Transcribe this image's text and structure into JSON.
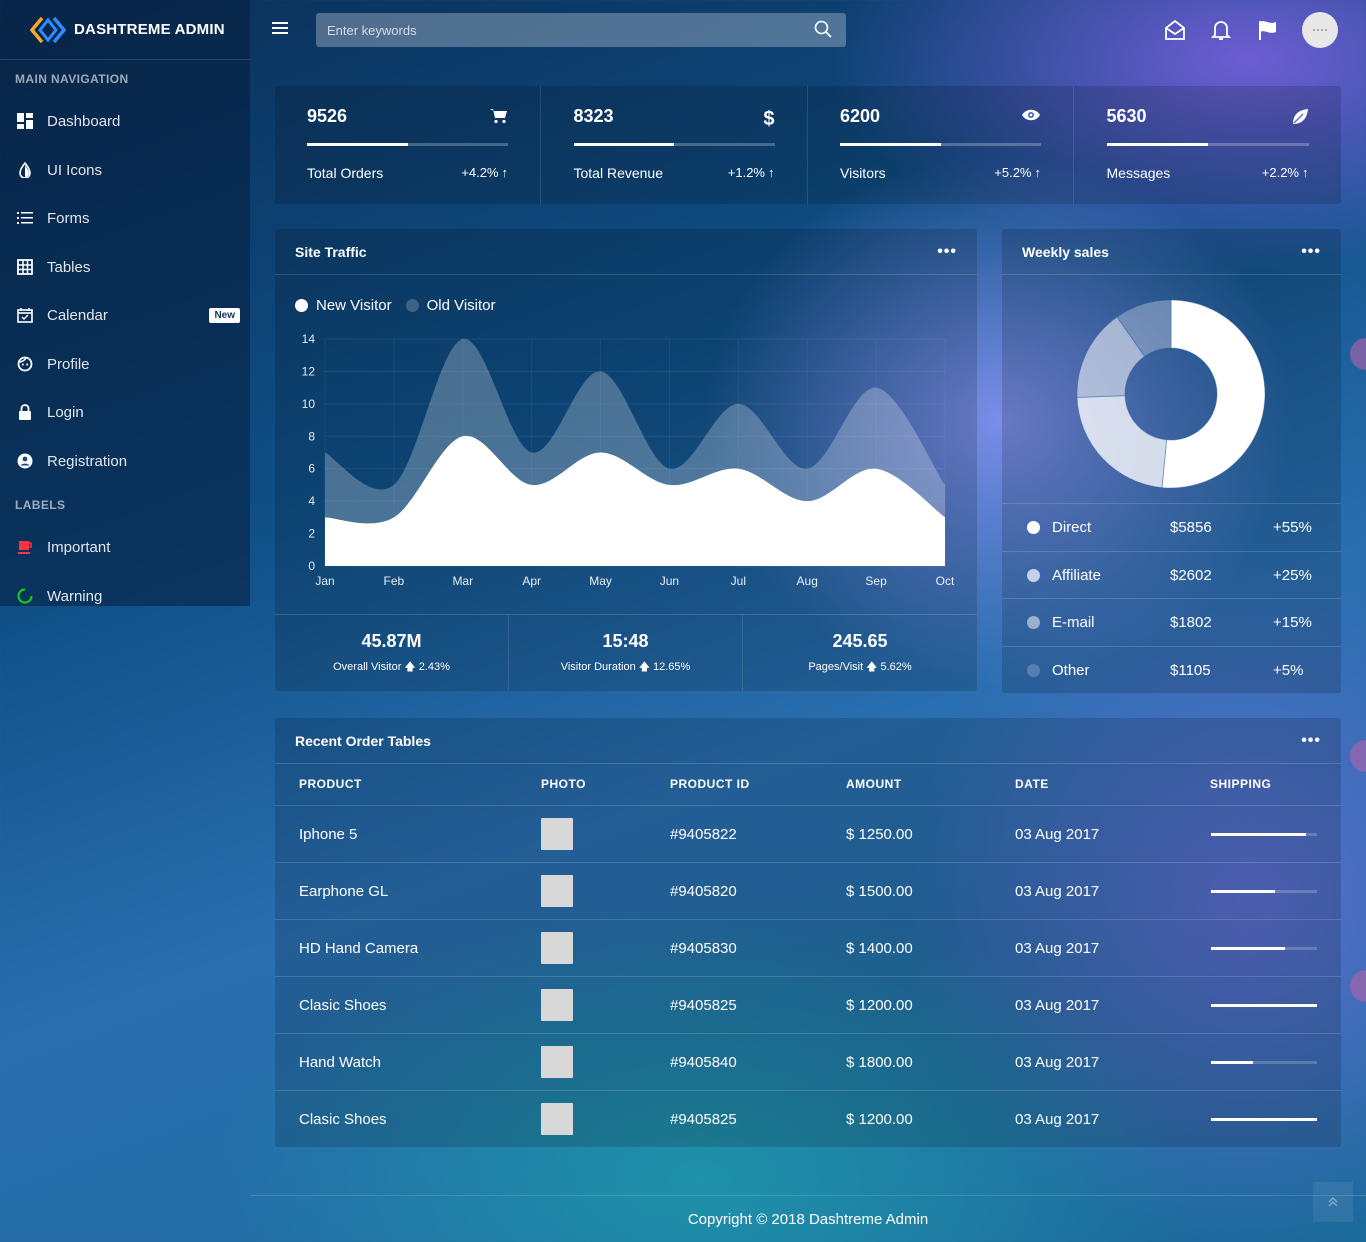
{
  "brand": {
    "title": "DASHTREME ADMIN"
  },
  "sidebar": {
    "main_header": "MAIN NAVIGATION",
    "items": [
      {
        "label": "Dashboard",
        "icon": "dashboard-icon"
      },
      {
        "label": "UI Icons",
        "icon": "contrast-icon"
      },
      {
        "label": "Forms",
        "icon": "list-icon"
      },
      {
        "label": "Tables",
        "icon": "grid-icon"
      },
      {
        "label": "Calendar",
        "icon": "calendar-icon",
        "badge": "New"
      },
      {
        "label": "Profile",
        "icon": "face-icon"
      },
      {
        "label": "Login",
        "icon": "lock-icon"
      },
      {
        "label": "Registration",
        "icon": "account-circle-icon"
      }
    ],
    "labels_header": "LABELS",
    "labels": [
      {
        "label": "Important",
        "icon": "coffee-icon",
        "color": "#f43643"
      },
      {
        "label": "Warning",
        "icon": "circle-notch-icon",
        "color": "#15ca20"
      }
    ]
  },
  "topbar": {
    "search_placeholder": "Enter keywords",
    "icons": [
      "envelope-open-icon",
      "bell-icon",
      "flag-icon"
    ]
  },
  "stats": [
    {
      "value": "9526",
      "label": "Total Orders",
      "delta": "+4.2%",
      "icon": "cart-icon",
      "progress": 0.5
    },
    {
      "value": "8323",
      "label": "Total Revenue",
      "delta": "+1.2%",
      "icon": "dollar-icon",
      "progress": 0.5
    },
    {
      "value": "6200",
      "label": "Visitors",
      "delta": "+5.2%",
      "icon": "eye-icon",
      "progress": 0.5
    },
    {
      "value": "5630",
      "label": "Messages",
      "delta": "+2.2%",
      "icon": "leaf-icon",
      "progress": 0.5
    }
  ],
  "traffic": {
    "title": "Site Traffic",
    "summary": [
      {
        "value": "45.87M",
        "label": "Overall Visitor",
        "delta": "2.43%"
      },
      {
        "value": "15:48",
        "label": "Visitor Duration",
        "delta": "12.65%"
      },
      {
        "value": "245.65",
        "label": "Pages/Visit",
        "delta": "5.62%"
      }
    ]
  },
  "chart_data": {
    "type": "area",
    "categories": [
      "Jan",
      "Feb",
      "Mar",
      "Apr",
      "May",
      "Jun",
      "Jul",
      "Aug",
      "Sep",
      "Oct"
    ],
    "series": [
      {
        "name": "New Visitor",
        "values": [
          3,
          3,
          8,
          5,
          7,
          5,
          6,
          4,
          6,
          3
        ],
        "color": "#ffffff"
      },
      {
        "name": "Old Visitor",
        "values": [
          7,
          5,
          14,
          7,
          12,
          6,
          10,
          6,
          11,
          5
        ],
        "color": "rgba(255,255,255,0.25)"
      }
    ],
    "yticks": [
      "0",
      "2",
      "4",
      "6",
      "8",
      "10",
      "12",
      "14"
    ],
    "ylim": [
      0,
      14
    ],
    "grid": true,
    "legend": "top-left"
  },
  "weekly": {
    "title": "Weekly sales",
    "rows": [
      {
        "name": "Direct",
        "amount": "$5856",
        "pct": "+55%",
        "value": 5856,
        "color": "#ffffff"
      },
      {
        "name": "Affiliate",
        "amount": "$2602",
        "pct": "+25%",
        "value": 2602,
        "color": "rgba(255,255,255,0.7)"
      },
      {
        "name": "E-mail",
        "amount": "$1802",
        "pct": "+15%",
        "value": 1802,
        "color": "rgba(255,255,255,0.5)"
      },
      {
        "name": "Other",
        "amount": "$1105",
        "pct": "+5%",
        "value": 1105,
        "color": "rgba(255,255,255,0.2)"
      }
    ]
  },
  "orders": {
    "title": "Recent Order Tables",
    "headers": [
      "PRODUCT",
      "PHOTO",
      "PRODUCT ID",
      "AMOUNT",
      "DATE",
      "SHIPPING"
    ],
    "rows": [
      {
        "product": "Iphone 5",
        "id": "#9405822",
        "amount": "$ 1250.00",
        "date": "03 Aug 2017",
        "shipping": 0.9
      },
      {
        "product": "Earphone GL",
        "id": "#9405820",
        "amount": "$ 1500.00",
        "date": "03 Aug 2017",
        "shipping": 0.6
      },
      {
        "product": "HD Hand Camera",
        "id": "#9405830",
        "amount": "$ 1400.00",
        "date": "03 Aug 2017",
        "shipping": 0.7
      },
      {
        "product": "Clasic Shoes",
        "id": "#9405825",
        "amount": "$ 1200.00",
        "date": "03 Aug 2017",
        "shipping": 1.0
      },
      {
        "product": "Hand Watch",
        "id": "#9405840",
        "amount": "$ 1800.00",
        "date": "03 Aug 2017",
        "shipping": 0.4
      },
      {
        "product": "Clasic Shoes",
        "id": "#9405825",
        "amount": "$ 1200.00",
        "date": "03 Aug 2017",
        "shipping": 1.0
      }
    ]
  },
  "footer": {
    "copyright": "Copyright © 2018 Dashtreme Admin"
  }
}
